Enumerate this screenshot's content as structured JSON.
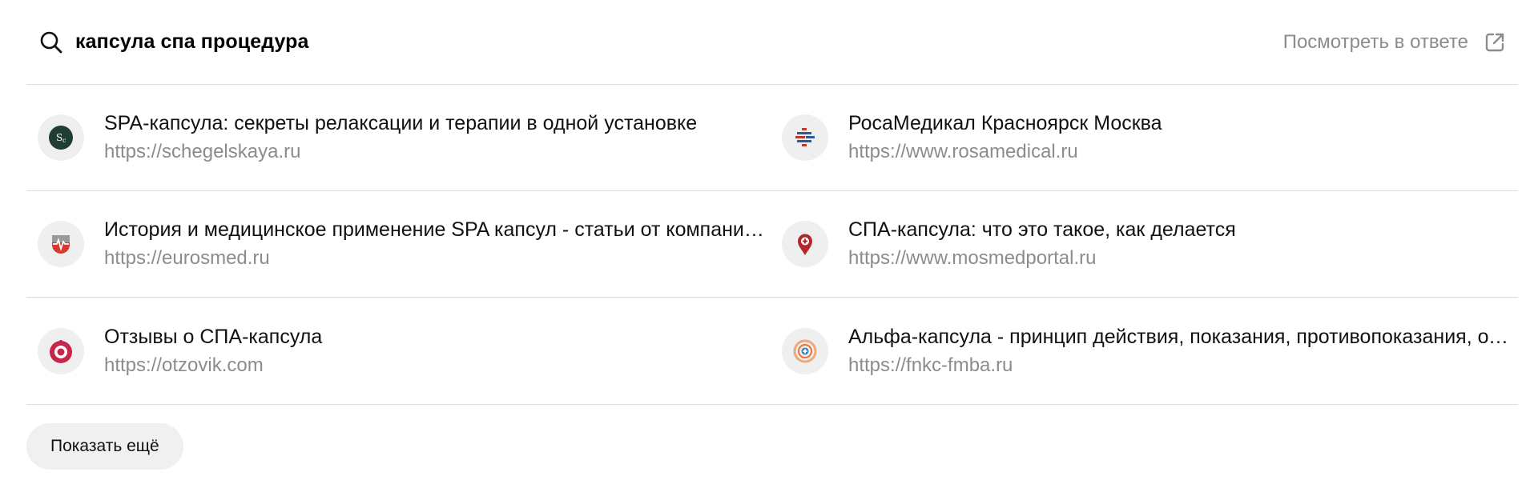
{
  "header": {
    "query": "капсула спа процедура",
    "view_link_label": "Посмотреть в ответе"
  },
  "results": [
    {
      "title": "SPA-капсула: секреты релаксации и терапии в одной установке",
      "url": "https://schegelskaya.ru",
      "icon": "schegelskaya-favicon-icon"
    },
    {
      "title": "РосаМедикал Красноярск Москва",
      "url": "https://www.rosamedical.ru",
      "icon": "rosamedical-favicon-icon"
    },
    {
      "title": "История и медицинское применение SPA капсул - статьи от компании Евросмед",
      "url": "https://eurosmed.ru",
      "icon": "eurosmed-favicon-icon"
    },
    {
      "title": "СПА-капсула: что это такое, как делается",
      "url": "https://www.mosmedportal.ru",
      "icon": "mosmedportal-favicon-icon"
    },
    {
      "title": "Отзывы о СПА-капсула",
      "url": "https://otzovik.com",
      "icon": "otzovik-favicon-icon"
    },
    {
      "title": "Альфа-капсула - принцип действия, показания, противопоказания, отзывы",
      "url": "https://fnkc-fmba.ru",
      "icon": "fnkc-fmba-favicon-icon"
    }
  ],
  "show_more_label": "Показать ещё",
  "colors": {
    "muted_text": "#8c8c8c",
    "divider": "#dcdcdc",
    "favicon_bg": "#efefef",
    "button_bg": "#f0f0f0"
  }
}
